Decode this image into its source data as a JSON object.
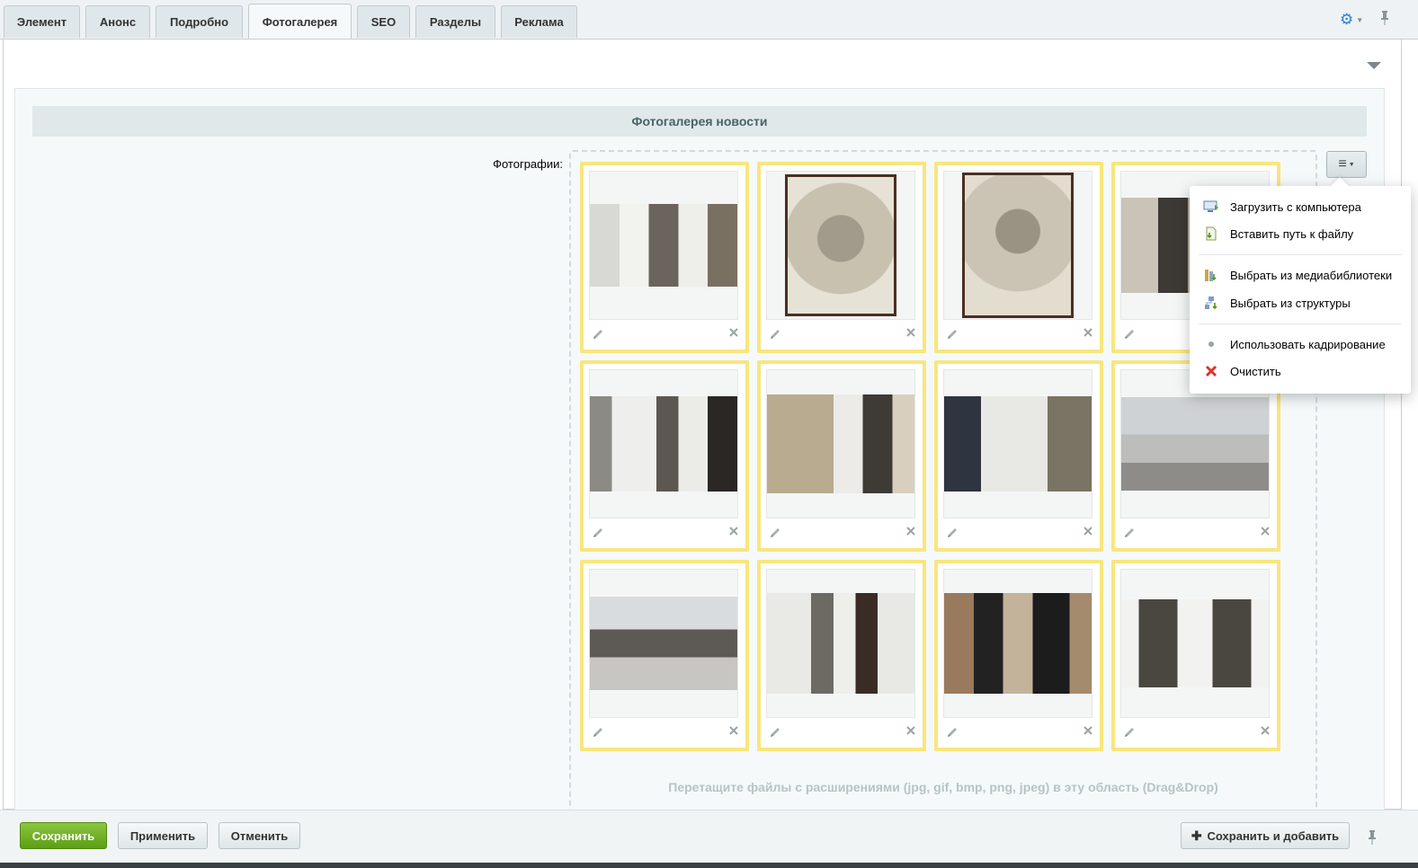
{
  "tabs": [
    {
      "label": "Элемент"
    },
    {
      "label": "Анонс"
    },
    {
      "label": "Подробно"
    },
    {
      "label": "Фотогалерея",
      "active": true
    },
    {
      "label": "SEO"
    },
    {
      "label": "Разделы"
    },
    {
      "label": "Реклама"
    }
  ],
  "section": {
    "title": "Фотогалерея новости"
  },
  "field": {
    "label": "Фотографии:"
  },
  "dropzone": {
    "hint": "Перетащите файлы с расширениями (jpg, gif, bmp, png, jpeg) в эту область (Drag&Drop)"
  },
  "photos": [
    {
      "name": "photo-1"
    },
    {
      "name": "photo-2"
    },
    {
      "name": "photo-3"
    },
    {
      "name": "photo-4"
    },
    {
      "name": "photo-5"
    },
    {
      "name": "photo-6"
    },
    {
      "name": "photo-7"
    },
    {
      "name": "photo-8"
    },
    {
      "name": "photo-9"
    },
    {
      "name": "photo-10"
    },
    {
      "name": "photo-11"
    },
    {
      "name": "photo-12"
    }
  ],
  "menu": {
    "items": [
      {
        "label": "Загрузить с компьютера",
        "icon": "computer-upload-icon"
      },
      {
        "label": "Вставить путь к файлу",
        "icon": "file-path-icon"
      },
      {
        "label": "Выбрать из медиабиблиотеки",
        "icon": "medialibrary-icon"
      },
      {
        "label": "Выбрать из структуры",
        "icon": "structure-icon"
      },
      {
        "label": "Использовать кадрирование",
        "icon": "bullet-icon"
      },
      {
        "label": "Очистить",
        "icon": "clear-icon"
      }
    ]
  },
  "footer": {
    "save": "Сохранить",
    "apply": "Применить",
    "cancel": "Отменить",
    "save_add": "Сохранить и добавить"
  },
  "colors": {
    "accent": "#5b9e14",
    "photo_border": "#f8e67e",
    "gear": "#2f7ed8"
  }
}
